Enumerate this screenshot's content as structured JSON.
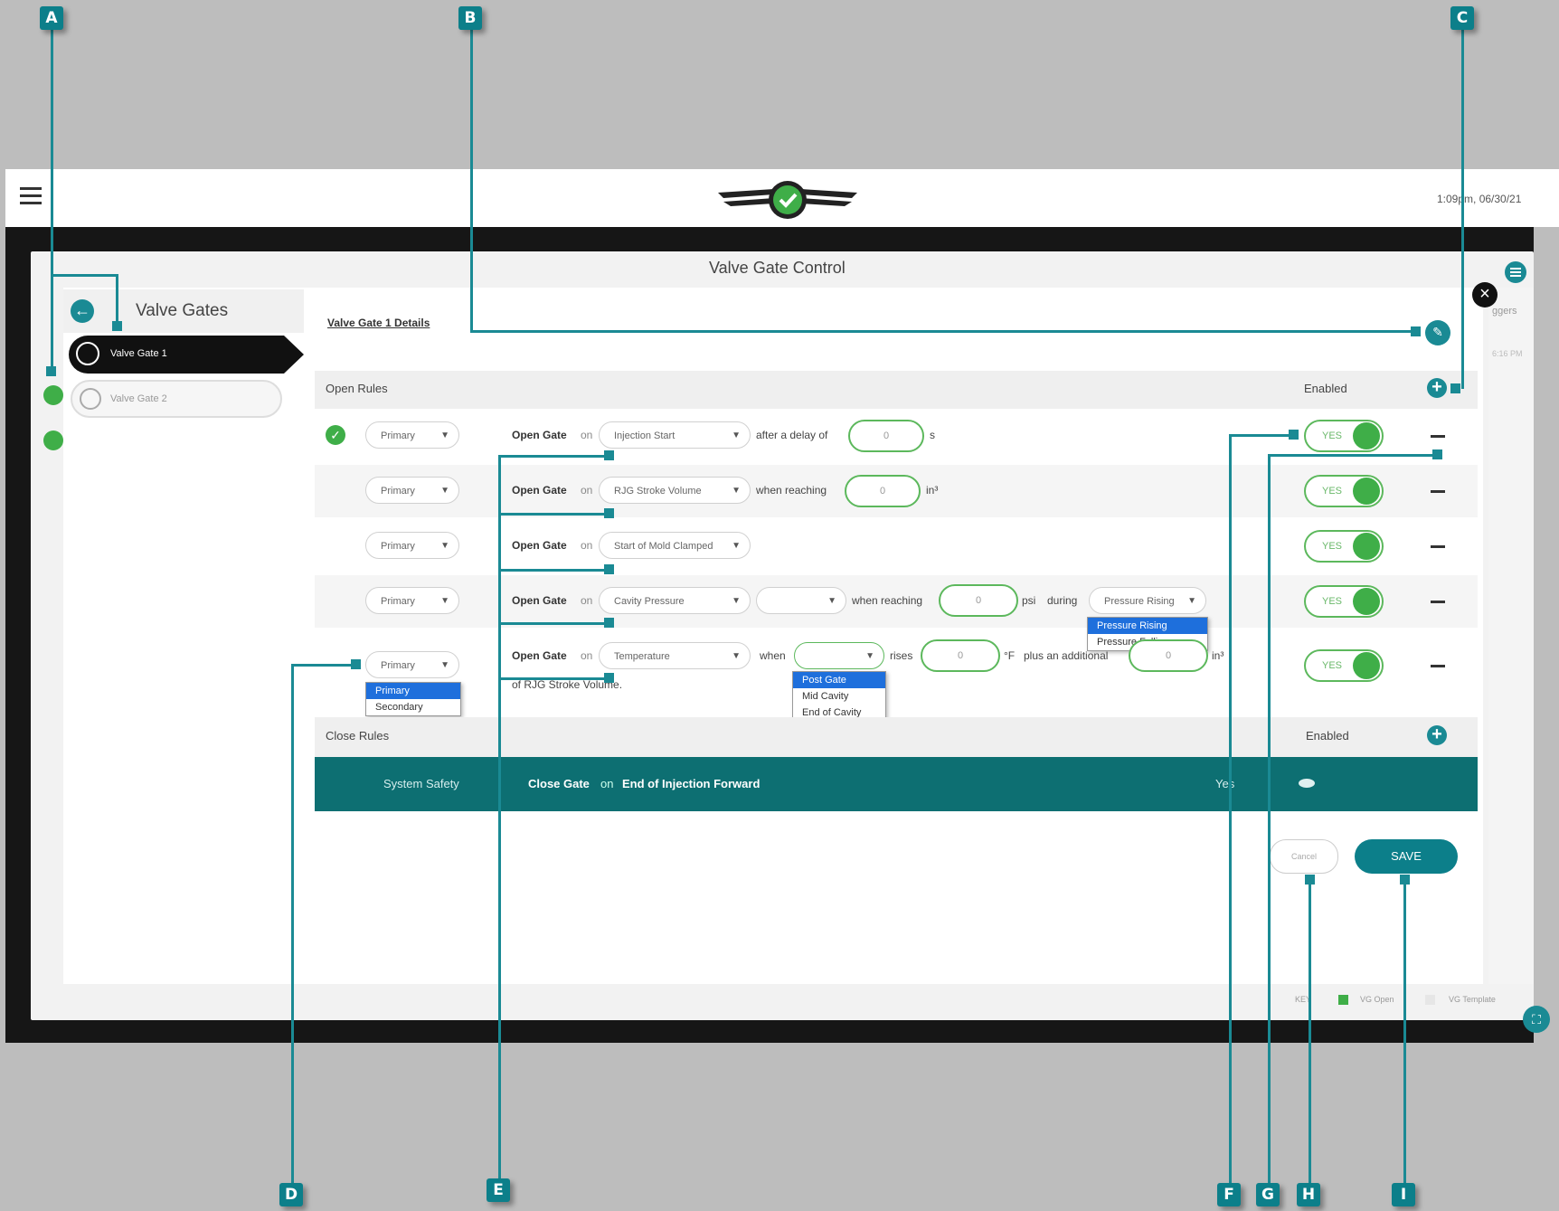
{
  "callouts": {
    "a": "A",
    "b": "B",
    "c": "C",
    "d": "D",
    "e": "E",
    "f": "F",
    "g": "G",
    "h": "H",
    "i": "I"
  },
  "header": {
    "timestamp": "1:09pm, 06/30/21"
  },
  "page_title": "Valve Gate Control",
  "sidebar": {
    "title": "Valve Gates",
    "items": [
      {
        "label": "Valve Gate 1"
      },
      {
        "label": "Valve Gate 2"
      }
    ]
  },
  "details": {
    "label": "Valve Gate 1 Details"
  },
  "right_strip": {
    "text1": "ggers",
    "text2": "6:16 PM"
  },
  "open_rules": {
    "header": "Open Rules",
    "enabled_label": "Enabled",
    "rows": [
      {
        "priority": "Primary",
        "action": "Open Gate",
        "on": "on",
        "trigger": "Injection Start",
        "cond": "after a delay of",
        "value": "0",
        "unit": "s",
        "toggle": "YES"
      },
      {
        "priority": "Primary",
        "action": "Open Gate",
        "on": "on",
        "trigger": "RJG Stroke Volume",
        "cond": "when reaching",
        "value": "0",
        "unit": "in³",
        "toggle": "YES"
      },
      {
        "priority": "Primary",
        "action": "Open Gate",
        "on": "on",
        "trigger": "Start of Mold Clamped",
        "toggle": "YES"
      },
      {
        "priority": "Primary",
        "action": "Open Gate",
        "on": "on",
        "trigger": "Cavity Pressure",
        "cond": "when reaching",
        "value": "0",
        "unit": "psi",
        "during": "during",
        "during_value": "Pressure Rising",
        "toggle": "YES"
      },
      {
        "priority": "Primary",
        "action": "Open Gate",
        "on": "on",
        "trigger": "Temperature",
        "when": "when",
        "rises": "rises",
        "value": "0",
        "unit": "°F",
        "plus": "plus an additional",
        "value2": "0",
        "unit2": "in³",
        "cont": "of RJG Stroke Volume.",
        "toggle": "YES"
      }
    ]
  },
  "dropdowns": {
    "priority_options": [
      "Primary",
      "Secondary"
    ],
    "pressure_options": [
      "Pressure Rising",
      "Pressure Falling"
    ],
    "location_options": [
      "Post Gate",
      "Mid Cavity",
      "End of Cavity"
    ]
  },
  "close_rules": {
    "header": "Close Rules",
    "enabled_label": "Enabled",
    "row": {
      "name": "System Safety",
      "action": "Close Gate",
      "on": "on",
      "trigger": "End of Injection Forward",
      "enabled": "Yes"
    }
  },
  "buttons": {
    "cancel": "Cancel",
    "save": "SAVE"
  },
  "key": {
    "label": "KEY",
    "open": "VG Open",
    "template": "VG Template"
  },
  "colors": {
    "teal": "#0c7f8a",
    "dark_teal": "#0d6f72",
    "green": "#3fae48"
  }
}
